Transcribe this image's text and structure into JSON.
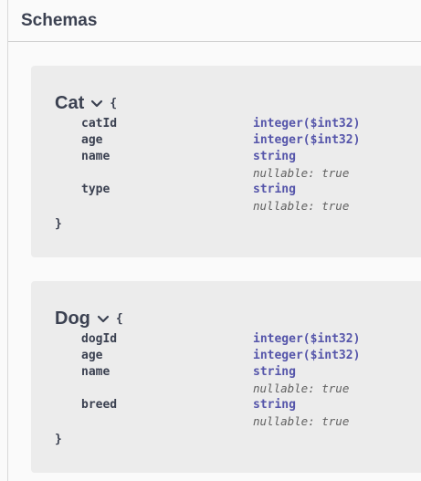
{
  "section": {
    "title": "Schemas"
  },
  "braces": {
    "open": "{",
    "close": "}"
  },
  "models": [
    {
      "name": "Cat",
      "properties": [
        {
          "name": "catId",
          "type": "integer($int32)"
        },
        {
          "name": "age",
          "type": "integer($int32)"
        },
        {
          "name": "name",
          "type": "string",
          "note": "nullable: true"
        },
        {
          "name": "type",
          "type": "string",
          "note": "nullable: true"
        }
      ]
    },
    {
      "name": "Dog",
      "properties": [
        {
          "name": "dogId",
          "type": "integer($int32)"
        },
        {
          "name": "age",
          "type": "integer($int32)"
        },
        {
          "name": "name",
          "type": "string",
          "note": "nullable: true"
        },
        {
          "name": "breed",
          "type": "string",
          "note": "nullable: true"
        }
      ]
    }
  ],
  "colors": {
    "type": "#5555aa",
    "title": "#3b4151",
    "panel": "#ececec"
  },
  "icons": {
    "expand": "chevron-down-icon"
  }
}
